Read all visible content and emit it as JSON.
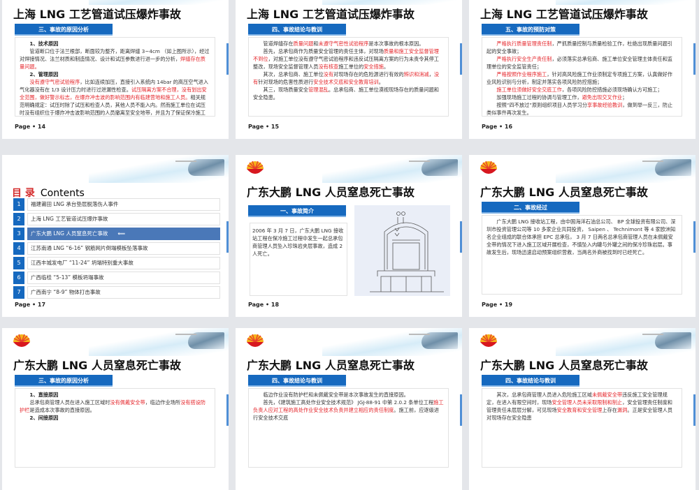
{
  "slides": [
    {
      "kind": "text",
      "page": "Page • 14",
      "title": "上海 LNG 工艺管道试压爆炸事故",
      "section": "三、事故的原因分析",
      "logo": false,
      "paras": [
        [
          {
            "t": "1、技术原因",
            "s": "bold"
          }
        ],
        [
          {
            "t": "管道断口位于法兰根部，断面较为整齐，距离焊缝 3~4cm （如上图所示），经过对焊接情况、法兰材质和制造情况、设计和试压参数进行进一步的分析，"
          },
          {
            "t": "焊缝存在质量问题。",
            "s": "red"
          }
        ],
        [
          {
            "t": "2、管理原因",
            "s": "bold"
          }
        ],
        [
          {
            "t": "没有遵守气密试验程序",
            "s": "red"
          },
          {
            "t": "，比如连续加压，直接引入系统内 14bar 的高压空气进入气化器没有在 1/3 设计压力时进行过泄漏性检查。"
          },
          {
            "t": "试压隔离方案不合理，没有划出安全范围，做好警示标志，在爆炸冲击波的影响范围内有临建营地和施工人员。",
            "s": "red"
          },
          {
            "t": "相关规范明确规定：试压时除了试压和检查人员，其他人员不能入内。然而施工单位在试压时没有组织位于爆炸冲击波影响范围的人员撤离至安全地带，并且为了保证保冷施工的继续进行，还组织工人在设备管道周边作业搭设脚手架。"
          }
        ]
      ]
    },
    {
      "kind": "text",
      "page": "Page • 15",
      "title": "上海 LNG 工艺管道试压爆炸事故",
      "section": "四、事故结论与教训",
      "logo": false,
      "paras": [
        [
          {
            "t": "管道焊缝存在"
          },
          {
            "t": "质量问题",
            "s": "red"
          },
          {
            "t": "和"
          },
          {
            "t": "未遵守气密性试验程序",
            "s": "red"
          },
          {
            "t": "是本次事故的根本原因。"
          }
        ],
        [
          {
            "t": "首先，总承包商作为质量安全管理的责任主体，对现场"
          },
          {
            "t": "质量和施工安全监督管理不到位",
            "s": "red"
          },
          {
            "t": "，对施工单位没有遵守气密试验程序和违反试压隔离方案的行为未责令其停工整改，现场安全监督管理人员"
          },
          {
            "t": "没有核查",
            "s": "red"
          },
          {
            "t": "施工单位的"
          },
          {
            "t": "安全措施",
            "s": "red"
          },
          {
            "t": "。"
          }
        ],
        [
          {
            "t": "其次，总承包商、施工单位"
          },
          {
            "t": "没有",
            "s": "red"
          },
          {
            "t": "对现场存在的危险源进行有效的"
          },
          {
            "t": "辨识和消减",
            "s": "red"
          },
          {
            "t": "，"
          },
          {
            "t": "没有",
            "s": "red"
          },
          {
            "t": "针对现场的危害性质进行"
          },
          {
            "t": "安全技术交底和安全教育培训",
            "s": "red"
          },
          {
            "t": "。"
          }
        ],
        [
          {
            "t": "其三，现场质量安全"
          },
          {
            "t": "管理混乱",
            "s": "red"
          },
          {
            "t": "。总承包商、施工单位漠视现场存在的质量问题和安全隐患。"
          }
        ]
      ]
    },
    {
      "kind": "text",
      "page": "Page • 16",
      "title": "上海 LNG 工艺管道试压爆炸事故",
      "section": "五、事故的预防对策",
      "logo": false,
      "paras": [
        [
          {
            "t": "严格执行质量管理责任制",
            "s": "red"
          },
          {
            "t": "，严抓质量控制与质量检验工作，杜绝出现质量问题引起的安全事故；"
          }
        ],
        [
          {
            "t": "严格执行安全生产责任制",
            "s": "red"
          },
          {
            "t": "，必须落实总承包商、施工单位安全管理主体责任和监理单位的安全监管责任；"
          }
        ],
        [
          {
            "t": "严格按照作业程序施工",
            "s": "red"
          },
          {
            "t": "，针对高风险施工作业须制定专项施工方案，认真做好作业风险识别与分析，制定并落实各项风险防控措施；"
          }
        ],
        [
          {
            "t": "施工单位须做好安全交底工作",
            "s": "red"
          },
          {
            "t": "，各项风险防控措施必须现场确认方可施工；"
          }
        ],
        [
          {
            "t": "加强现场施工过程的协调与管理工作，"
          },
          {
            "t": "避免出现交叉作业",
            "s": "red"
          },
          {
            "t": "；"
          }
        ],
        [
          {
            "t": "按照“四不放过”原则组织项目人员学习分"
          },
          {
            "t": "享事故经验教训",
            "s": "red"
          },
          {
            "t": "，做到举一反三，防止类似事件再次发生。"
          }
        ]
      ]
    },
    {
      "kind": "toc",
      "page": "Page • 17",
      "title_cn": "目 录",
      "title_en": "Contents",
      "active": 2,
      "arrow": "⟸",
      "items": [
        {
          "num": "1",
          "label": "福建莆田 LNG 承台垫层脱落伤人事件"
        },
        {
          "num": "2",
          "label": "上海 LNG 工艺管道试压爆炸事故"
        },
        {
          "num": "3",
          "label": "广东大鹏 LNG 人员窒息死亡事故"
        },
        {
          "num": "4",
          "label": "江苏南通 LNG “6-16” 钢筋网片倒塌模板坠落事故"
        },
        {
          "num": "5",
          "label": "江西丰城发电厂 “11-24” 坍塌特别重大事故"
        },
        {
          "num": "6",
          "label": "广西临桂 “5-13” 模板坍塌事故"
        },
        {
          "num": "7",
          "label": "广西南宁 “8-9” 物体打击事故"
        }
      ]
    },
    {
      "kind": "intro",
      "page": "Page • 18",
      "title": "广东大鹏 LNG 人员窒息死亡事故",
      "section": "一、事故简介",
      "logo": true,
      "text": "2006 年 3 月 7 日，广东大鹏 LNG 接收站工程在保冷施工过程中发生一起总承包商管理人员坠入珍珠岩夹层事故，造成 2 人死亡。"
    },
    {
      "kind": "text",
      "page": "Page • 19",
      "title": "广东大鹏 LNG 人员窒息死亡事故",
      "section": "二、事故经过",
      "logo": true,
      "paras": [
        [
          {
            "t": "广东大鹏 LNG 接收站工程，由中国海洋石油总公司、 BP 全球投资有限公司、深圳市投资管理公司等 10 多家企业共同投资， Saipen 、 Technimont 等 4 家欧洲知名企业组成的联合体承担 EPC 总承包， 3 月 7 日两名总承包商管理人员在未佩戴安全带的情况下进入施工区域开展检查，不慎坠入内罐与外罐之间的保冷珍珠岩层。事故发生后，现场迅速启动预案组织营救，当两名外商被找到时已经死亡。"
          }
        ]
      ]
    },
    {
      "kind": "text",
      "page": "",
      "title": "广东大鹏 LNG 人员窒息死亡事故",
      "section": "三、事故的原因分析",
      "logo": true,
      "paras": [
        [
          {
            "t": "1、直接原因",
            "s": "bold"
          }
        ],
        [
          {
            "t": "总承包商管理人员在进入施工区域时"
          },
          {
            "t": "没有佩戴安全带",
            "s": "red"
          },
          {
            "t": "，临边作业场所"
          },
          {
            "t": "没有搭设防护栏",
            "s": "red"
          },
          {
            "t": "是造成本次事故的直接原因。"
          }
        ],
        [
          {
            "t": "2、间接原因",
            "s": "bold"
          }
        ]
      ]
    },
    {
      "kind": "text",
      "page": "",
      "title": "广东大鹏 LNG 人员窒息死亡事故",
      "section": "四、事故结论与教训",
      "logo": true,
      "paras": [
        [
          {
            "t": "临边作业没有防护栏和未佩戴安全带是本次事故发生的直接原因。"
          }
        ],
        [
          {
            "t": "首先，《建筑施工高处作业安全技术规范》 JGJ-88-91 中第 2.0.2 条单位工程"
          },
          {
            "t": "施工负责人应对工程的高处作业安全技术负责并建立相应的责任制度",
            "s": "red"
          },
          {
            "t": "。施工前，应逐级进行安全技术交底"
          }
        ]
      ]
    },
    {
      "kind": "text",
      "page": "",
      "title": "广东大鹏 LNG 人员窒息死亡事故",
      "section": "四、事故结论与教训",
      "logo": true,
      "paras": [
        [
          {
            "t": "其次，总承包商管理人员进入危险施工区域"
          },
          {
            "t": "未佩戴安全带",
            "s": "red"
          },
          {
            "t": "违反施工安全管理规定，在进入有限空间时，现场"
          },
          {
            "t": "安全管理人员未采取限制和制止",
            "s": "red"
          },
          {
            "t": "，安全管理责任制度和管理责任未层层分解，可见现场"
          },
          {
            "t": "安全教育和安全管理",
            "s": "red"
          },
          {
            "t": "上存在"
          },
          {
            "t": "漏洞",
            "s": "red"
          },
          {
            "t": "。正是安全管理人员对现场存在安全隐患"
          }
        ]
      ]
    }
  ],
  "colors": {
    "accent": "#1669bf",
    "highlight": "#e5262b",
    "toc_active": "#4a78b8"
  }
}
